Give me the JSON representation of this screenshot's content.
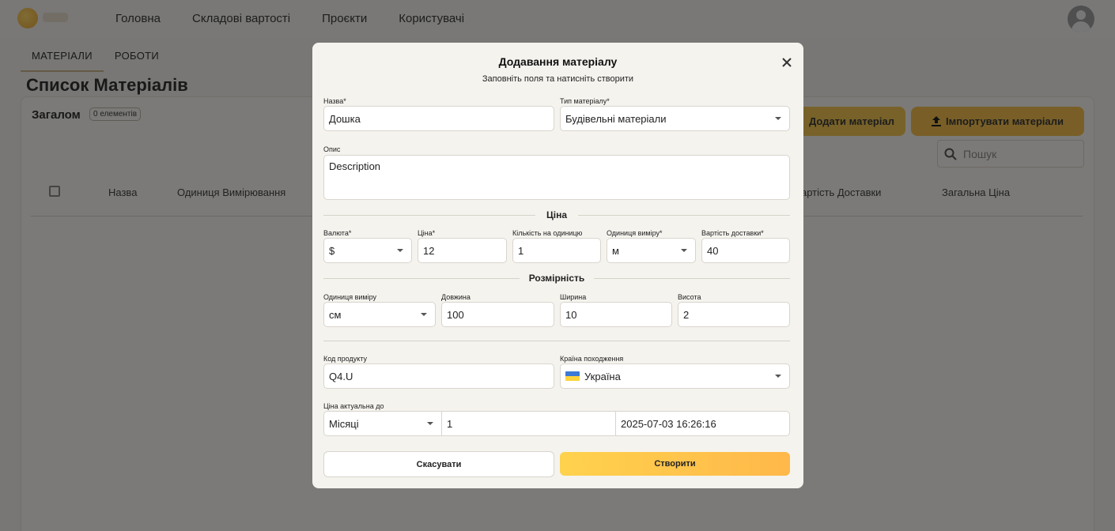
{
  "nav": {
    "items": [
      "Головна",
      "Складові вартості",
      "Проєкти",
      "Користувачі"
    ]
  },
  "subtabs": [
    "МАТЕРІАЛИ",
    "РОБОТИ"
  ],
  "page": {
    "title": "Список Матеріалів",
    "card_title": "Загалом",
    "count_badge": "0 елементів",
    "add_button": "Додати матеріал",
    "import_button": "Імпортувати матеріали",
    "search_placeholder": "Пошук",
    "columns": [
      "Назва",
      "Одиниця Вимірювання",
      "артість Доставки",
      "Загальна Ціна"
    ]
  },
  "modal": {
    "title": "Додавання матеріалу",
    "subtitle": "Заповніть поля та натисніть створити",
    "name_label": "Назва*",
    "name_value": "Дошка",
    "type_label": "Тип матеріалу*",
    "type_value": "Будівельні матеріали",
    "description_label": "Опис",
    "description_value": "Description",
    "price_section": "Ціна",
    "currency_label": "Валюта*",
    "currency_value": "$",
    "price_label": "Ціна*",
    "price_value": "12",
    "qty_label": "Кількість на одиницю",
    "qty_value": "1",
    "unit_label": "Одиниця виміру*",
    "unit_value": "м",
    "delivery_label": "Вартість доставки*",
    "delivery_value": "40",
    "dims_section": "Розмірність",
    "dim_unit_label": "Одиниця виміру",
    "dim_unit_value": "см",
    "length_label": "Довжина",
    "length_value": "100",
    "width_label": "Ширина",
    "width_value": "10",
    "height_label": "Висота",
    "height_value": "2",
    "code_label": "Код продукту",
    "code_value": "Q4.U",
    "country_label": "Країна походження",
    "country_value": "Україна",
    "valid_label": "Ціна актуальна до",
    "period_value": "Місяці",
    "period_count_value": "1",
    "valid_date_value": "2025-07-03 16:26:16",
    "cancel_button": "Скасувати",
    "create_button": "Створити"
  },
  "colors": {
    "accent": "#ffc94a",
    "overlay": "#000000",
    "modal_bg": "#f5f3ee"
  }
}
